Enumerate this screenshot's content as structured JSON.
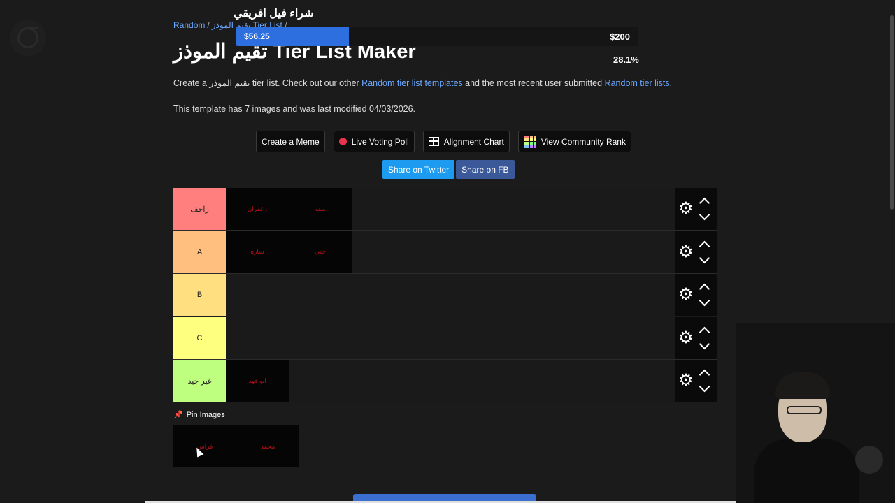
{
  "goal": {
    "title": "شراء فيل افريقي",
    "current": "$56.25",
    "target": "$200",
    "percent_text": "28.1%",
    "progress": 0.281
  },
  "breadcrumb": {
    "root": "Random",
    "sep": "/",
    "current": "تقيم الموذز Tier List",
    "trail": "/"
  },
  "title": "تقيم الموذز Tier List Maker",
  "intro": {
    "before": "Create a تقيم الموذز tier list. Check out our other ",
    "link1": "Random tier list templates",
    "middle": " and the most recent user submitted ",
    "link2": "Random tier lists",
    "after": "."
  },
  "info_text": "This template has 7 images and was last modified 04/03/2026.",
  "buttons": {
    "meme": "Create a Meme",
    "poll": "Live Voting Poll",
    "alignment": "Alignment Chart",
    "community": "View Community Rank"
  },
  "share": {
    "twitter": "Share on Twitter",
    "facebook": "Share on FB"
  },
  "tiers": [
    {
      "label": "زاحف",
      "color": "#ff7f7f",
      "items": [
        "زعفران",
        "مينه"
      ]
    },
    {
      "label": "A",
      "color": "#ffbf7f",
      "items": [
        "ساره",
        "جني"
      ]
    },
    {
      "label": "B",
      "color": "#ffdf7f",
      "items": []
    },
    {
      "label": "C",
      "color": "#ffff7f",
      "items": []
    },
    {
      "label": "غير جيد",
      "color": "#bfff7f",
      "items": [
        "ابو فهد"
      ]
    }
  ],
  "pin": {
    "label": "Pin Images",
    "items": [
      "فراس",
      "محمد"
    ]
  }
}
